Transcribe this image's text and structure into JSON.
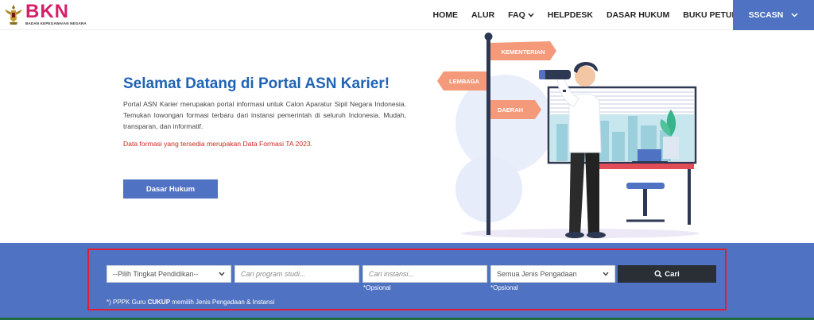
{
  "header": {
    "logo_text": "BKN",
    "logo_subtitle": "BADAN KEPEGAWAIAN NEGARA",
    "nav": [
      {
        "label": "HOME"
      },
      {
        "label": "ALUR"
      },
      {
        "label": "FAQ"
      },
      {
        "label": "HELPDESK"
      },
      {
        "label": "DASAR HUKUM"
      },
      {
        "label": "BUKU PETUNJUK"
      }
    ],
    "user_label": "SSCASN",
    "colors": {
      "brand": "#d61f69",
      "accent": "#4f72c2"
    }
  },
  "hero": {
    "title": "Selamat Datang di Portal ASN Karier!",
    "description": "Portal ASN Karier merupakan portal informasi untuk Calon Aparatur Sipil Negara Indonesia. Temukan lowongan formasi terbaru dari instansi pemerintah di seluruh Indonesia. Mudah, transparan, dan informatif.",
    "note": "Data formasi yang tersedia merupakan Data Formasi TA 2023.",
    "button_label": "Dasar Hukum",
    "signs": {
      "sign1": "KEMENTERIAN",
      "sign2": "LEMBAGA",
      "sign3": "DAERAH"
    }
  },
  "search": {
    "education_select": "--Pilih Tingkat Pendidikan--",
    "program_placeholder": "Cari program studi...",
    "instansi_placeholder": "Cari instansi...",
    "instansi_hint": "*Opsional",
    "jenis_select": "Semua Jenis Pengadaan",
    "jenis_hint": "*Opsional",
    "search_button": "Cari",
    "footnote_prefix": "*) PPPK Guru ",
    "footnote_bold": "CUKUP",
    "footnote_suffix": " memilih Jenis Pengadaan & Instansi"
  }
}
